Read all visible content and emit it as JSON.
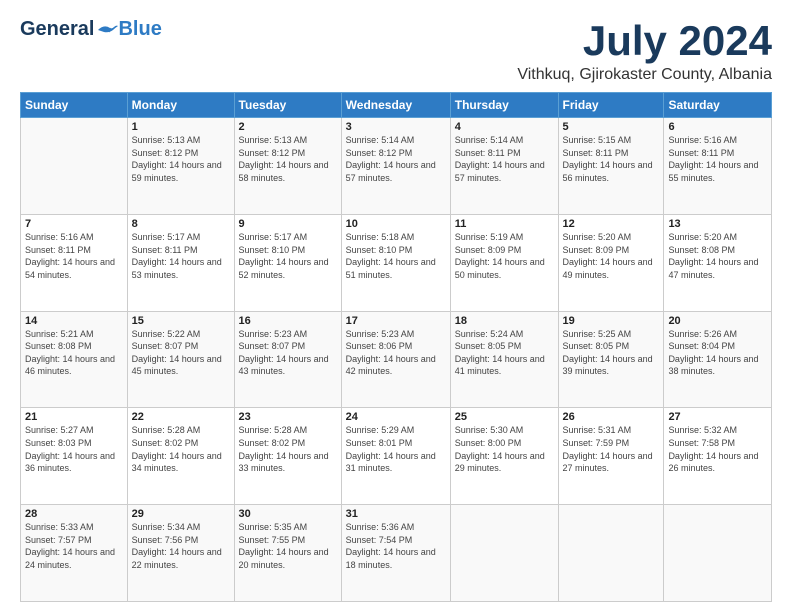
{
  "header": {
    "logo_general": "General",
    "logo_blue": "Blue",
    "month": "July 2024",
    "location": "Vithkuq, Gjirokaster County, Albania"
  },
  "weekdays": [
    "Sunday",
    "Monday",
    "Tuesday",
    "Wednesday",
    "Thursday",
    "Friday",
    "Saturday"
  ],
  "weeks": [
    [
      {
        "day": "",
        "sunrise": "",
        "sunset": "",
        "daylight": ""
      },
      {
        "day": "1",
        "sunrise": "Sunrise: 5:13 AM",
        "sunset": "Sunset: 8:12 PM",
        "daylight": "Daylight: 14 hours and 59 minutes."
      },
      {
        "day": "2",
        "sunrise": "Sunrise: 5:13 AM",
        "sunset": "Sunset: 8:12 PM",
        "daylight": "Daylight: 14 hours and 58 minutes."
      },
      {
        "day": "3",
        "sunrise": "Sunrise: 5:14 AM",
        "sunset": "Sunset: 8:12 PM",
        "daylight": "Daylight: 14 hours and 57 minutes."
      },
      {
        "day": "4",
        "sunrise": "Sunrise: 5:14 AM",
        "sunset": "Sunset: 8:11 PM",
        "daylight": "Daylight: 14 hours and 57 minutes."
      },
      {
        "day": "5",
        "sunrise": "Sunrise: 5:15 AM",
        "sunset": "Sunset: 8:11 PM",
        "daylight": "Daylight: 14 hours and 56 minutes."
      },
      {
        "day": "6",
        "sunrise": "Sunrise: 5:16 AM",
        "sunset": "Sunset: 8:11 PM",
        "daylight": "Daylight: 14 hours and 55 minutes."
      }
    ],
    [
      {
        "day": "7",
        "sunrise": "Sunrise: 5:16 AM",
        "sunset": "Sunset: 8:11 PM",
        "daylight": "Daylight: 14 hours and 54 minutes."
      },
      {
        "day": "8",
        "sunrise": "Sunrise: 5:17 AM",
        "sunset": "Sunset: 8:11 PM",
        "daylight": "Daylight: 14 hours and 53 minutes."
      },
      {
        "day": "9",
        "sunrise": "Sunrise: 5:17 AM",
        "sunset": "Sunset: 8:10 PM",
        "daylight": "Daylight: 14 hours and 52 minutes."
      },
      {
        "day": "10",
        "sunrise": "Sunrise: 5:18 AM",
        "sunset": "Sunset: 8:10 PM",
        "daylight": "Daylight: 14 hours and 51 minutes."
      },
      {
        "day": "11",
        "sunrise": "Sunrise: 5:19 AM",
        "sunset": "Sunset: 8:09 PM",
        "daylight": "Daylight: 14 hours and 50 minutes."
      },
      {
        "day": "12",
        "sunrise": "Sunrise: 5:20 AM",
        "sunset": "Sunset: 8:09 PM",
        "daylight": "Daylight: 14 hours and 49 minutes."
      },
      {
        "day": "13",
        "sunrise": "Sunrise: 5:20 AM",
        "sunset": "Sunset: 8:08 PM",
        "daylight": "Daylight: 14 hours and 47 minutes."
      }
    ],
    [
      {
        "day": "14",
        "sunrise": "Sunrise: 5:21 AM",
        "sunset": "Sunset: 8:08 PM",
        "daylight": "Daylight: 14 hours and 46 minutes."
      },
      {
        "day": "15",
        "sunrise": "Sunrise: 5:22 AM",
        "sunset": "Sunset: 8:07 PM",
        "daylight": "Daylight: 14 hours and 45 minutes."
      },
      {
        "day": "16",
        "sunrise": "Sunrise: 5:23 AM",
        "sunset": "Sunset: 8:07 PM",
        "daylight": "Daylight: 14 hours and 43 minutes."
      },
      {
        "day": "17",
        "sunrise": "Sunrise: 5:23 AM",
        "sunset": "Sunset: 8:06 PM",
        "daylight": "Daylight: 14 hours and 42 minutes."
      },
      {
        "day": "18",
        "sunrise": "Sunrise: 5:24 AM",
        "sunset": "Sunset: 8:05 PM",
        "daylight": "Daylight: 14 hours and 41 minutes."
      },
      {
        "day": "19",
        "sunrise": "Sunrise: 5:25 AM",
        "sunset": "Sunset: 8:05 PM",
        "daylight": "Daylight: 14 hours and 39 minutes."
      },
      {
        "day": "20",
        "sunrise": "Sunrise: 5:26 AM",
        "sunset": "Sunset: 8:04 PM",
        "daylight": "Daylight: 14 hours and 38 minutes."
      }
    ],
    [
      {
        "day": "21",
        "sunrise": "Sunrise: 5:27 AM",
        "sunset": "Sunset: 8:03 PM",
        "daylight": "Daylight: 14 hours and 36 minutes."
      },
      {
        "day": "22",
        "sunrise": "Sunrise: 5:28 AM",
        "sunset": "Sunset: 8:02 PM",
        "daylight": "Daylight: 14 hours and 34 minutes."
      },
      {
        "day": "23",
        "sunrise": "Sunrise: 5:28 AM",
        "sunset": "Sunset: 8:02 PM",
        "daylight": "Daylight: 14 hours and 33 minutes."
      },
      {
        "day": "24",
        "sunrise": "Sunrise: 5:29 AM",
        "sunset": "Sunset: 8:01 PM",
        "daylight": "Daylight: 14 hours and 31 minutes."
      },
      {
        "day": "25",
        "sunrise": "Sunrise: 5:30 AM",
        "sunset": "Sunset: 8:00 PM",
        "daylight": "Daylight: 14 hours and 29 minutes."
      },
      {
        "day": "26",
        "sunrise": "Sunrise: 5:31 AM",
        "sunset": "Sunset: 7:59 PM",
        "daylight": "Daylight: 14 hours and 27 minutes."
      },
      {
        "day": "27",
        "sunrise": "Sunrise: 5:32 AM",
        "sunset": "Sunset: 7:58 PM",
        "daylight": "Daylight: 14 hours and 26 minutes."
      }
    ],
    [
      {
        "day": "28",
        "sunrise": "Sunrise: 5:33 AM",
        "sunset": "Sunset: 7:57 PM",
        "daylight": "Daylight: 14 hours and 24 minutes."
      },
      {
        "day": "29",
        "sunrise": "Sunrise: 5:34 AM",
        "sunset": "Sunset: 7:56 PM",
        "daylight": "Daylight: 14 hours and 22 minutes."
      },
      {
        "day": "30",
        "sunrise": "Sunrise: 5:35 AM",
        "sunset": "Sunset: 7:55 PM",
        "daylight": "Daylight: 14 hours and 20 minutes."
      },
      {
        "day": "31",
        "sunrise": "Sunrise: 5:36 AM",
        "sunset": "Sunset: 7:54 PM",
        "daylight": "Daylight: 14 hours and 18 minutes."
      },
      {
        "day": "",
        "sunrise": "",
        "sunset": "",
        "daylight": ""
      },
      {
        "day": "",
        "sunrise": "",
        "sunset": "",
        "daylight": ""
      },
      {
        "day": "",
        "sunrise": "",
        "sunset": "",
        "daylight": ""
      }
    ]
  ]
}
